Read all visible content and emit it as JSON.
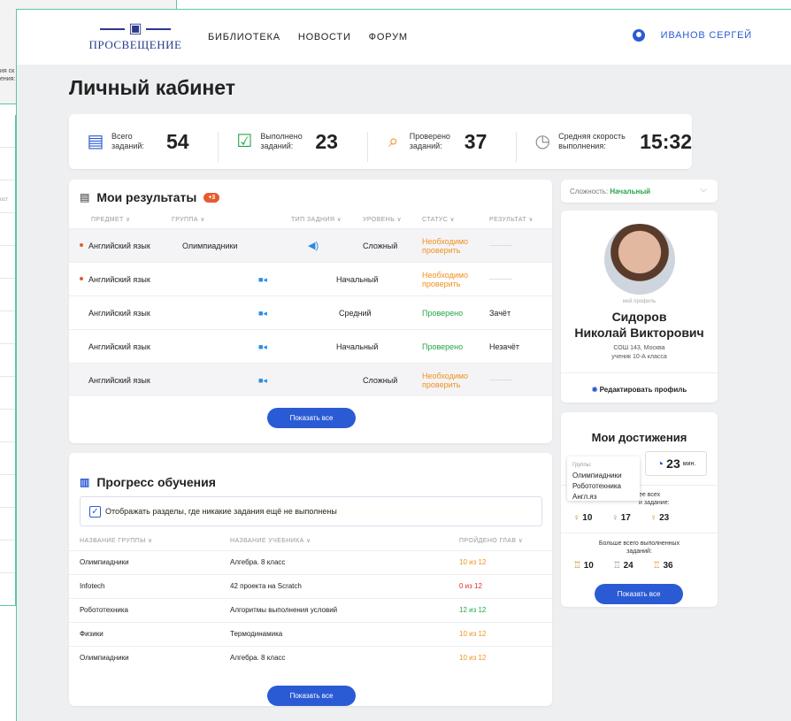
{
  "bg": {
    "line1": "ия ск",
    "line2": "ения:",
    "col": "ост"
  },
  "header": {
    "logo": "ПРОСВЕЩЕНИЕ",
    "nav": [
      "БИБЛИОТЕКА",
      "НОВОСТИ",
      "ФОРУМ"
    ],
    "user": "ИВАНОВ СЕРГЕЙ"
  },
  "page_title": "Личный кабинет",
  "stats": [
    {
      "icon": "clipboard-icon",
      "label": "Всего заданий:",
      "value": "54"
    },
    {
      "icon": "check-square-icon",
      "label": "Выполнено заданий:",
      "value": "23"
    },
    {
      "icon": "search-check-icon",
      "label": "Проверено заданий:",
      "value": "37"
    },
    {
      "icon": "stopwatch-icon",
      "label": "Средняя скорость выполнения:",
      "value": "15:32"
    }
  ],
  "results": {
    "title": "Мои результаты",
    "badge": "+3",
    "headers": [
      "ПРЕДМЕТ ∨",
      "ГРУППА ∨",
      "ТИП ЗАДНИЯ ∨",
      "УРОВЕНЬ ∨",
      "СТАТУС ∨",
      "РЕЗУЛЬТАТ ∨"
    ],
    "rows": [
      {
        "subject": "Английский язык",
        "group": "Олимпиадники",
        "type": "audio",
        "level": "Сложный",
        "status": "Необходимо проверить",
        "result": "",
        "dot": true,
        "shade": true
      },
      {
        "subject": "Английский язык",
        "group": "",
        "type": "video",
        "level": "Начальный",
        "status": "Необходимо проверить",
        "result": "",
        "dot": true,
        "shade": false
      },
      {
        "subject": "Английский язык",
        "group": "",
        "type": "video",
        "level": "Средний",
        "status": "Проверено",
        "result": "Зачёт",
        "dot": false,
        "shade": false
      },
      {
        "subject": "Английский язык",
        "group": "",
        "type": "video",
        "level": "Начальный",
        "status": "Проверено",
        "result": "Незачёт",
        "dot": false,
        "shade": false
      },
      {
        "subject": "Английский язык",
        "group": "",
        "type": "video",
        "level": "Сложный",
        "status": "Необходимо проверить",
        "result": "",
        "dot": false,
        "shade": true
      }
    ],
    "show_all": "Показать все"
  },
  "difficulty": {
    "label": "Сложность: ",
    "value": "Начальный"
  },
  "profile": {
    "caption": "мой профиль",
    "name1": "Сидоров",
    "name2": "Николай Викторович",
    "school": "СОШ 143, Москва",
    "grade": "ученик 10-А класса",
    "edit": "Редактировать профиль"
  },
  "achievements": {
    "title": "Мои достижения",
    "time": "23",
    "time_unit": "мин.",
    "tooltip": {
      "label": "Группы:",
      "items": [
        "Олимпиадники",
        "Робототехника",
        "Англ.яз"
      ]
    },
    "block1": {
      "line1": "ее всех",
      "line2": "и задание:",
      "trophies": [
        "10",
        "17",
        "23"
      ]
    },
    "block2": {
      "line1": "Больше всего выполненных",
      "line2": "заданий:",
      "trophies": [
        "10",
        "24",
        "36"
      ]
    },
    "show_all": "Показать все"
  },
  "progress": {
    "title": "Прогресс обучения",
    "checkbox": "Отображать разделы, где никакие задания ещё не выполнены",
    "headers": [
      "НАЗВАНИЕ ГРУППЫ ∨",
      "НАЗВАНИЕ УЧЕБНИКА ∨",
      "ПРОЙДЕНО ГЛАВ ∨"
    ],
    "rows": [
      {
        "group": "Олимпиадники",
        "book": "Алгебра. 8 класс",
        "done": "10 из 12",
        "color": "o"
      },
      {
        "group": "Infotech",
        "book": "42 проекта на Scratch",
        "done": "0 из 12",
        "color": "r"
      },
      {
        "group": "Робототехника",
        "book": "Алгоритмы выполнения условий",
        "done": "12 из 12",
        "color": "g"
      },
      {
        "group": "Физики",
        "book": "Термодинамика",
        "done": "10 из 12",
        "color": "o"
      },
      {
        "group": "Олимпиадники",
        "book": "Алгебра. 8 класс",
        "done": "10 из 12",
        "color": "o"
      }
    ],
    "show_all": "Показать все"
  }
}
